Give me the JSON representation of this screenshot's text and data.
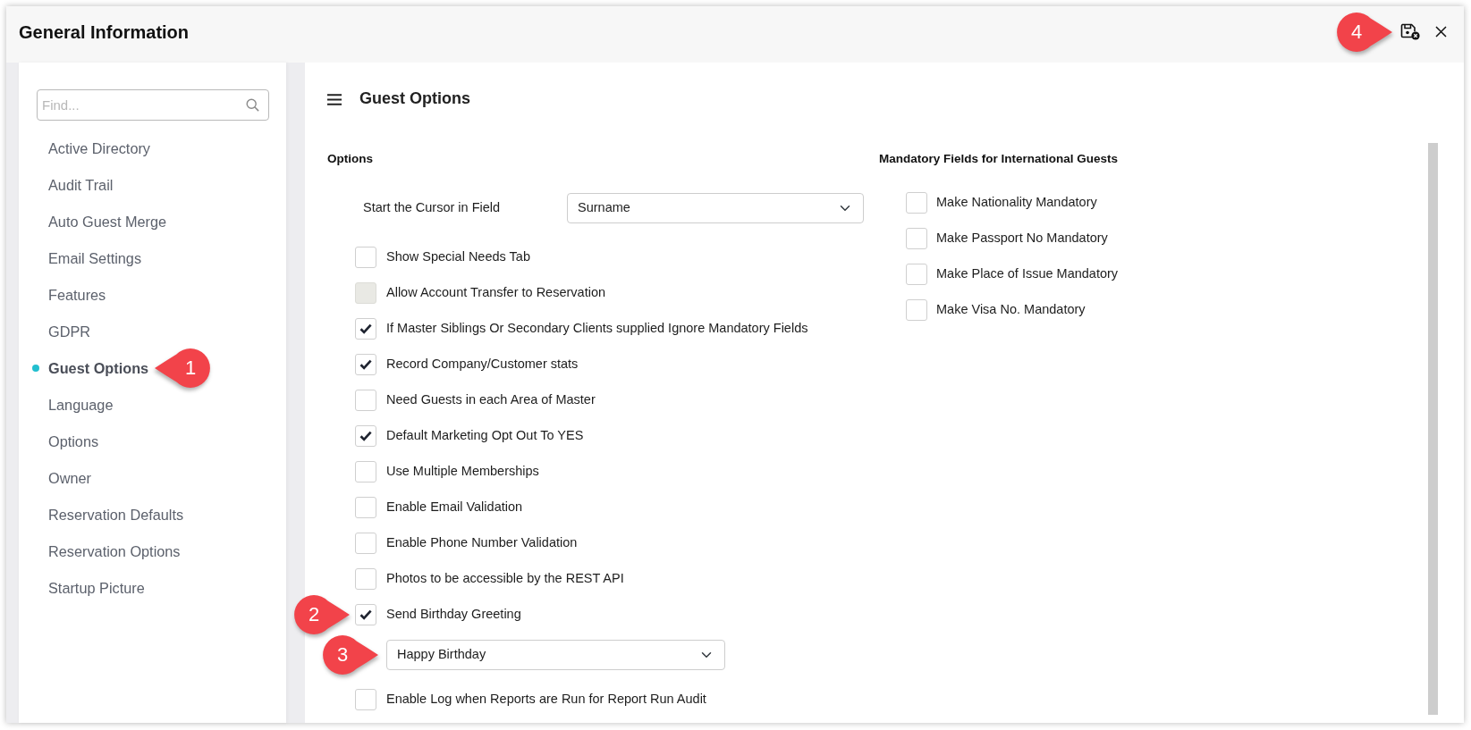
{
  "header": {
    "title": "General Information",
    "save_callout": "4"
  },
  "sidebar": {
    "search": {
      "placeholder": "Find..."
    },
    "items": [
      {
        "label": "Active Directory",
        "selected": false
      },
      {
        "label": "Audit Trail",
        "selected": false
      },
      {
        "label": "Auto Guest Merge",
        "selected": false
      },
      {
        "label": "Email Settings",
        "selected": false
      },
      {
        "label": "Features",
        "selected": false
      },
      {
        "label": "GDPR",
        "selected": false
      },
      {
        "label": "Guest Options",
        "selected": true,
        "callout": "1"
      },
      {
        "label": "Language",
        "selected": false
      },
      {
        "label": "Options",
        "selected": false
      },
      {
        "label": "Owner",
        "selected": false
      },
      {
        "label": "Reservation Defaults",
        "selected": false
      },
      {
        "label": "Reservation Options",
        "selected": false
      },
      {
        "label": "Startup Picture",
        "selected": false
      }
    ]
  },
  "main": {
    "title": "Guest Options",
    "options": {
      "heading": "Options",
      "rows": [
        {
          "kind": "field",
          "label": "Start the Cursor in Field",
          "value": "Surname",
          "disabled": false
        },
        {
          "kind": "checkbox",
          "label": "Show Special Needs Tab",
          "checked": false,
          "disabled": false
        },
        {
          "kind": "checkbox",
          "label": "Allow Account Transfer to Reservation",
          "checked": false,
          "disabled": true
        },
        {
          "kind": "checkbox",
          "label": "If Master Siblings Or Secondary Clients supplied Ignore Mandatory Fields",
          "checked": true,
          "disabled": false
        },
        {
          "kind": "checkbox",
          "label": "Record Company/Customer stats",
          "checked": true,
          "disabled": false
        },
        {
          "kind": "checkbox",
          "label": "Need Guests in each Area of Master",
          "checked": false,
          "disabled": false
        },
        {
          "kind": "checkbox",
          "label": "Default Marketing Opt Out To YES",
          "checked": true,
          "disabled": false
        },
        {
          "kind": "checkbox",
          "label": "Use Multiple Memberships",
          "checked": false,
          "disabled": false
        },
        {
          "kind": "checkbox",
          "label": "Enable Email Validation",
          "checked": false,
          "disabled": false
        },
        {
          "kind": "checkbox",
          "label": "Enable Phone Number Validation",
          "checked": false,
          "disabled": false
        },
        {
          "kind": "checkbox",
          "label": "Photos to be accessible by the REST API",
          "checked": false,
          "disabled": false
        },
        {
          "kind": "checkbox",
          "label": "Send Birthday Greeting",
          "checked": true,
          "disabled": false,
          "callout": "2"
        },
        {
          "kind": "select",
          "value": "Happy Birthday",
          "disabled": false,
          "callout": "3"
        },
        {
          "kind": "checkbox",
          "label": "Enable Log when Reports are Run for Report Run Audit",
          "checked": false,
          "disabled": false
        }
      ]
    },
    "mandatory": {
      "heading": "Mandatory Fields for International Guests",
      "rows": [
        {
          "label": "Make Nationality Mandatory",
          "checked": false
        },
        {
          "label": "Make Passport No Mandatory",
          "checked": false
        },
        {
          "label": "Make Place of Issue Mandatory",
          "checked": false
        },
        {
          "label": "Make Visa No. Mandatory",
          "checked": false
        }
      ]
    }
  }
}
